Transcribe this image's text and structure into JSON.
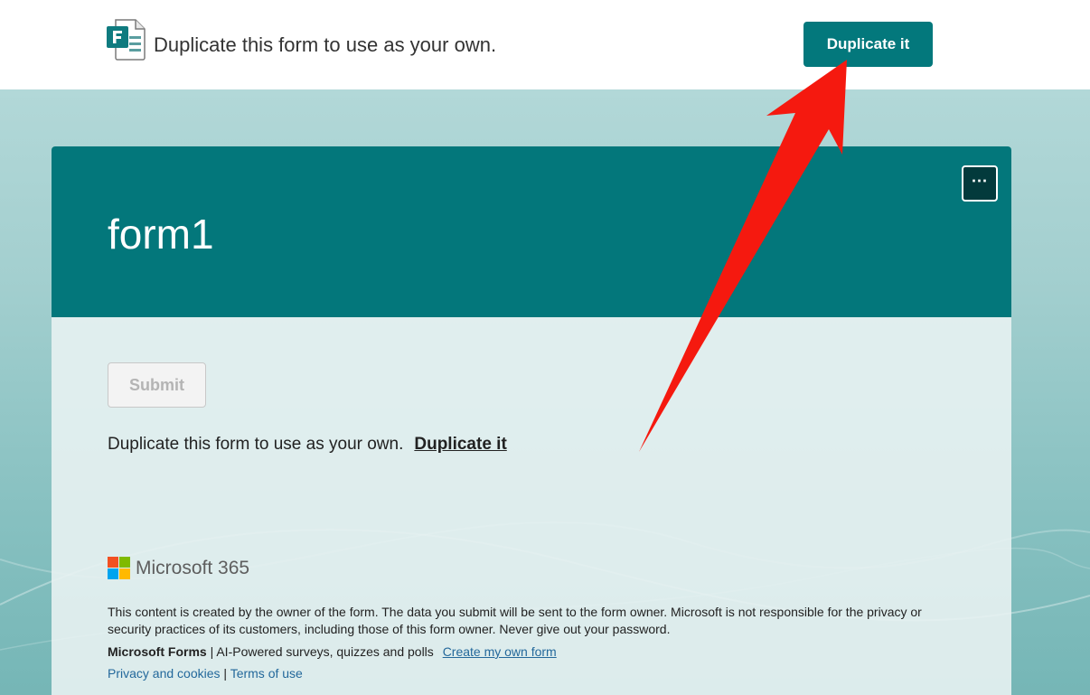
{
  "topbar": {
    "message": "Duplicate this form to use as your own.",
    "duplicate_button": "Duplicate it"
  },
  "form": {
    "title": "form1",
    "more_button": "⋯",
    "submit_button": "Submit",
    "duplicate_message": "Duplicate this form to use as your own.",
    "duplicate_link": "Duplicate it"
  },
  "footer": {
    "brand": "Microsoft 365",
    "disclaimer": "This content is created by the owner of the form. The data you submit will be sent to the form owner. Microsoft is not responsible for the privacy or security practices of its customers, including those of this form owner. Never give out your password.",
    "product_name": "Microsoft Forms",
    "separator": " | ",
    "product_tagline": "AI-Powered surveys, quizzes and polls",
    "create_link": "Create my own form",
    "privacy_link": "Privacy and cookies",
    "terms_link": "Terms of use"
  },
  "colors": {
    "accent": "#03787c",
    "header": "#03777b",
    "link": "#23689b",
    "arrow": "#f5190f"
  },
  "icons": {
    "forms_logo": "microsoft-forms-logo",
    "more": "ellipsis-icon",
    "microsoft_logo": "microsoft-logo"
  }
}
